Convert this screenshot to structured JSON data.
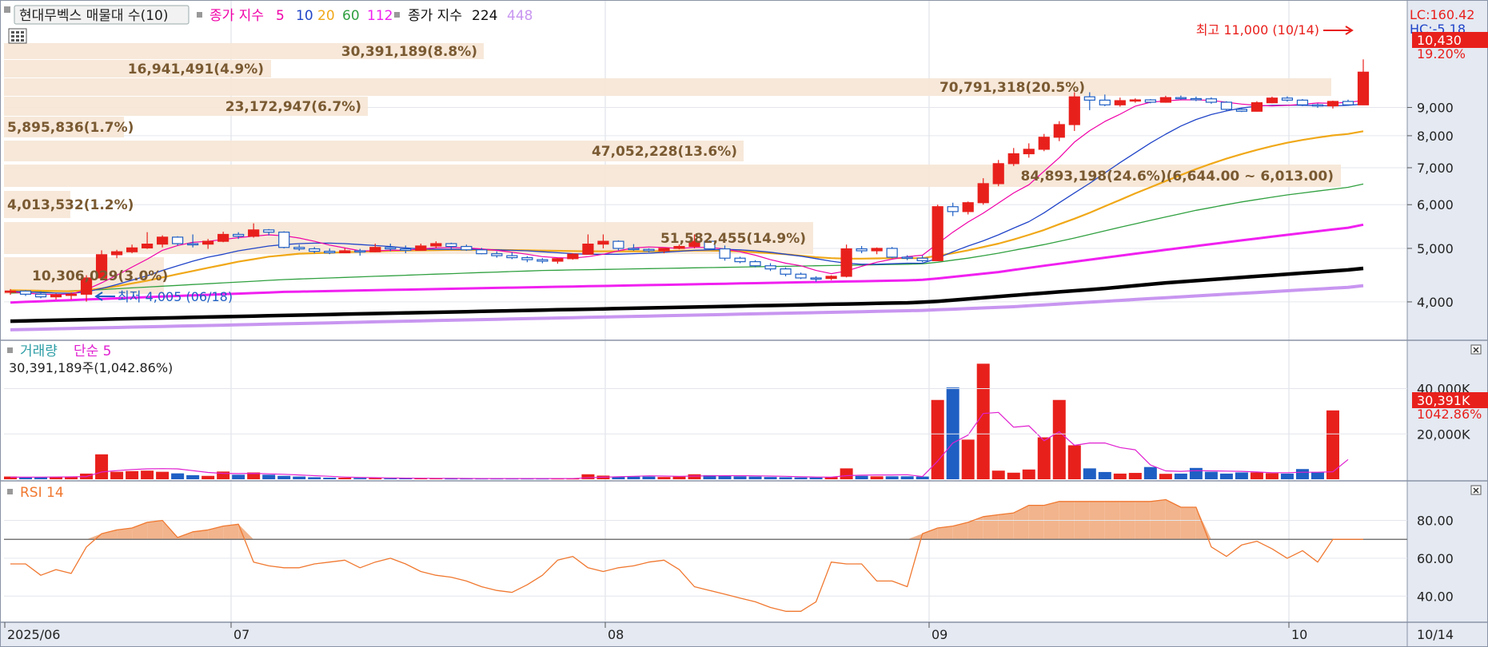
{
  "legend": {
    "title": "현대무벡스 매물대 수(10)",
    "close_label": "종가 지수",
    "ma_periods": [
      "5",
      "10",
      "20",
      "60",
      "112"
    ],
    "close_label_2": "종가 지수",
    "ma_long": [
      "224",
      "448"
    ]
  },
  "colors": {
    "up": "#e8201c",
    "down": "#1f5fc4",
    "ma5": "#f000a8",
    "ma10": "#2145c8",
    "ma20": "#f0a818",
    "ma60": "#30a040",
    "ma112": "#f020f0",
    "ma224": "#000000",
    "ma448": "#c896f0",
    "profile": "#f6e6d6",
    "profile_text": "#7a5a32",
    "rsi_line": "#f07830",
    "rsi_fill": "#f2b48c",
    "vol_ma": "#e020d0"
  },
  "right_axis": {
    "lc": "LC:160.42",
    "hc": "HC:-5.18",
    "price_tag": "10,430",
    "price_change": "19.20%",
    "price_ticks": [
      "9,000",
      "8,000",
      "7,000",
      "6,000",
      "5,000",
      "4,000"
    ],
    "volume_ticks": [
      "40,000K",
      "20,000K"
    ],
    "volume_tag": "30,391K",
    "volume_pct": "1042.86%",
    "rsi_ticks": [
      "80.00",
      "60.00",
      "40.00"
    ]
  },
  "annotations": {
    "high": "최고 11,000 (10/14)",
    "low": "최저 4,005 (06/18)"
  },
  "volume_profile": [
    {
      "label": "30,391,189(8.8%)"
    },
    {
      "label": "16,941,491(4.9%)"
    },
    {
      "label": "70,791,318(20.5%)"
    },
    {
      "label": "23,172,947(6.7%)"
    },
    {
      "label": "5,895,836(1.7%)"
    },
    {
      "label": "47,052,228(13.6%)"
    },
    {
      "label": "84,893,198(24.6%)(6,644.00 ~ 6,013.00)"
    },
    {
      "label": "4,013,532(1.2%)"
    },
    {
      "label": "51,582,455(14.9%)"
    },
    {
      "label": "10,306,029(3.0%)"
    }
  ],
  "volume_panel": {
    "title": "거래량",
    "ma_label": "단순 5",
    "value": "30,391,189주(1,042.86%)"
  },
  "rsi_panel": {
    "title": "RSI 14"
  },
  "x_axis": {
    "labels": [
      "2025/06",
      "07",
      "08",
      "09",
      "10"
    ],
    "current": "10/14"
  },
  "chart_data": {
    "type": "candlestick",
    "title": "현대무벡스",
    "y_scale": "log",
    "ylim": [
      3500,
      11500
    ],
    "candles": [
      [
        4163,
        4220,
        4120,
        4185
      ],
      [
        4185,
        4200,
        4100,
        4130
      ],
      [
        4130,
        4180,
        4060,
        4085
      ],
      [
        4085,
        4140,
        4040,
        4120
      ],
      [
        4120,
        4160,
        4040,
        4130
      ],
      [
        4130,
        4470,
        4005,
        4420
      ],
      [
        4420,
        4960,
        4400,
        4870
      ],
      [
        4870,
        4970,
        4800,
        4930
      ],
      [
        4930,
        5080,
        4900,
        5010
      ],
      [
        5010,
        5350,
        4990,
        5090
      ],
      [
        5090,
        5280,
        5020,
        5240
      ],
      [
        5240,
        5260,
        5060,
        5100
      ],
      [
        5100,
        5300,
        5020,
        5090
      ],
      [
        5090,
        5200,
        4990,
        5150
      ],
      [
        5150,
        5360,
        5130,
        5300
      ],
      [
        5300,
        5350,
        5200,
        5260
      ],
      [
        5260,
        5550,
        5230,
        5400
      ],
      [
        5400,
        5420,
        5280,
        5350
      ],
      [
        5350,
        5370,
        5000,
        5020
      ],
      [
        5020,
        5080,
        4950,
        4990
      ],
      [
        4990,
        5030,
        4900,
        4940
      ],
      [
        4940,
        5000,
        4880,
        4910
      ],
      [
        4910,
        5000,
        4900,
        4950
      ],
      [
        4950,
        4990,
        4850,
        4930
      ],
      [
        4930,
        5100,
        4920,
        5020
      ],
      [
        5020,
        5100,
        4940,
        4990
      ],
      [
        4990,
        5060,
        4900,
        4960
      ],
      [
        4960,
        5100,
        4950,
        5050
      ],
      [
        5050,
        5150,
        5000,
        5100
      ],
      [
        5100,
        5120,
        4980,
        5040
      ],
      [
        5040,
        5080,
        4950,
        4970
      ],
      [
        4970,
        5010,
        4880,
        4890
      ],
      [
        4890,
        4940,
        4810,
        4850
      ],
      [
        4850,
        4920,
        4780,
        4810
      ],
      [
        4810,
        4840,
        4720,
        4770
      ],
      [
        4770,
        4800,
        4700,
        4740
      ],
      [
        4740,
        4800,
        4690,
        4790
      ],
      [
        4790,
        4900,
        4770,
        4880
      ],
      [
        4880,
        5300,
        4870,
        5090
      ],
      [
        5090,
        5300,
        5000,
        5150
      ],
      [
        5150,
        5170,
        4960,
        5000
      ],
      [
        5000,
        5090,
        4950,
        4980
      ],
      [
        4980,
        5000,
        4920,
        4950
      ],
      [
        4950,
        5000,
        4900,
        5000
      ],
      [
        5000,
        5080,
        4980,
        5040
      ],
      [
        5040,
        5300,
        5000,
        5150
      ],
      [
        5150,
        5170,
        4960,
        4990
      ],
      [
        4990,
        5060,
        4750,
        4800
      ],
      [
        4800,
        4830,
        4700,
        4730
      ],
      [
        4730,
        4760,
        4620,
        4650
      ],
      [
        4650,
        4700,
        4550,
        4590
      ],
      [
        4590,
        4620,
        4450,
        4490
      ],
      [
        4490,
        4520,
        4400,
        4420
      ],
      [
        4420,
        4450,
        4350,
        4410
      ],
      [
        4410,
        4470,
        4380,
        4450
      ],
      [
        4450,
        5080,
        4430,
        4990
      ],
      [
        4990,
        5050,
        4900,
        4950
      ],
      [
        4950,
        5020,
        4880,
        5000
      ],
      [
        5000,
        5030,
        4800,
        4820
      ],
      [
        4820,
        4860,
        4760,
        4800
      ],
      [
        4800,
        4850,
        4720,
        4750
      ],
      [
        4750,
        6000,
        4740,
        5950
      ],
      [
        5950,
        6050,
        5720,
        5830
      ],
      [
        5830,
        6080,
        5760,
        6050
      ],
      [
        6050,
        6700,
        6000,
        6550
      ],
      [
        6550,
        7230,
        6480,
        7120
      ],
      [
        7120,
        7600,
        7050,
        7420
      ],
      [
        7420,
        7750,
        7300,
        7560
      ],
      [
        7560,
        8060,
        7500,
        7950
      ],
      [
        7950,
        8500,
        7820,
        8380
      ],
      [
        8380,
        9590,
        8160,
        9410
      ],
      [
        9410,
        9590,
        8900,
        9280
      ],
      [
        9280,
        9500,
        9050,
        9100
      ],
      [
        9100,
        9380,
        9030,
        9260
      ],
      [
        9260,
        9350,
        9180,
        9290
      ],
      [
        9290,
        9320,
        9160,
        9200
      ],
      [
        9200,
        9450,
        9180,
        9380
      ],
      [
        9380,
        9460,
        9300,
        9340
      ],
      [
        9340,
        9420,
        9240,
        9330
      ],
      [
        9330,
        9390,
        9140,
        9200
      ],
      [
        9200,
        9240,
        8880,
        8930
      ],
      [
        8930,
        8990,
        8830,
        8860
      ],
      [
        8860,
        9240,
        8850,
        9180
      ],
      [
        9180,
        9420,
        9160,
        9360
      ],
      [
        9360,
        9430,
        9220,
        9280
      ],
      [
        9280,
        9320,
        9050,
        9100
      ],
      [
        9100,
        9150,
        8990,
        9060
      ],
      [
        9060,
        9260,
        8960,
        9230
      ],
      [
        9230,
        9300,
        9060,
        9100
      ],
      [
        9100,
        11000,
        9090,
        10430
      ]
    ],
    "ma5": [
      4170,
      4150,
      4130,
      4125,
      4132,
      4210,
      4330,
      4470,
      4625,
      4780,
      4960,
      5060,
      5130,
      5150,
      5190,
      5230,
      5260,
      5290,
      5270,
      5220,
      5150,
      5070,
      5010,
      4950,
      4950,
      4960,
      4960,
      4990,
      5010,
      5020,
      5010,
      4990,
      4960,
      4920,
      4880,
      4830,
      4810,
      4800,
      4830,
      4880,
      4950,
      5010,
      5030,
      5020,
      5000,
      5020,
      5020,
      4990,
      4930,
      4860,
      4770,
      4700,
      4650,
      4560,
      4500,
      4550,
      4640,
      4720,
      4780,
      4830,
      4860,
      5100,
      5350,
      5580,
      5790,
      6040,
      6300,
      6520,
      6900,
      7300,
      7790,
      8170,
      8490,
      8750,
      9050,
      9200,
      9250,
      9290,
      9290,
      9270,
      9200,
      9130,
      9080,
      9060,
      9080,
      9120,
      9170,
      9160,
      9200,
      9260
    ],
    "ma10": [
      4180,
      4170,
      4160,
      4150,
      4145,
      4170,
      4230,
      4300,
      4380,
      4460,
      4560,
      4650,
      4740,
      4820,
      4880,
      4950,
      5000,
      5050,
      5080,
      5100,
      5110,
      5110,
      5100,
      5080,
      5060,
      5040,
      5010,
      4990,
      4980,
      4980,
      4980,
      4980,
      4970,
      4960,
      4950,
      4930,
      4910,
      4890,
      4880,
      4880,
      4880,
      4890,
      4900,
      4920,
      4940,
      4960,
      4970,
      4980,
      4970,
      4950,
      4920,
      4880,
      4840,
      4790,
      4740,
      4700,
      4680,
      4680,
      4690,
      4700,
      4700,
      4800,
      4930,
      5050,
      5160,
      5290,
      5440,
      5590,
      5800,
      6050,
      6300,
      6560,
      6850,
      7150,
      7450,
      7760,
      8050,
      8330,
      8560,
      8740,
      8870,
      8980,
      9050,
      9080,
      9090,
      9080,
      9070,
      9060,
      9080,
      9130
    ],
    "ma20": [
      4200,
      4195,
      4190,
      4185,
      4180,
      4200,
      4230,
      4270,
      4320,
      4370,
      4430,
      4490,
      4550,
      4610,
      4670,
      4730,
      4780,
      4830,
      4860,
      4890,
      4900,
      4910,
      4920,
      4930,
      4940,
      4950,
      4955,
      4960,
      4965,
      4970,
      4970,
      4970,
      4968,
      4965,
      4960,
      4955,
      4950,
      4945,
      4940,
      4940,
      4940,
      4940,
      4940,
      4945,
      4950,
      4955,
      4955,
      4950,
      4940,
      4920,
      4900,
      4880,
      4850,
      4820,
      4800,
      4790,
      4790,
      4795,
      4800,
      4800,
      4800,
      4850,
      4900,
      4960,
      5030,
      5100,
      5190,
      5290,
      5400,
      5530,
      5660,
      5800,
      5960,
      6120,
      6290,
      6450,
      6620,
      6790,
      6960,
      7120,
      7270,
      7410,
      7540,
      7660,
      7770,
      7860,
      7940,
      8010,
      8060,
      8150
    ],
    "ma60": [
      4150,
      4160,
      4170,
      4180,
      4190,
      4200,
      4210,
      4225,
      4240,
      4255,
      4270,
      4285,
      4300,
      4315,
      4330,
      4345,
      4360,
      4375,
      4390,
      4400,
      4410,
      4420,
      4430,
      4440,
      4450,
      4460,
      4470,
      4480,
      4490,
      4500,
      4510,
      4520,
      4530,
      4540,
      4550,
      4560,
      4565,
      4570,
      4575,
      4580,
      4585,
      4590,
      4595,
      4600,
      4605,
      4610,
      4615,
      4620,
      4625,
      4630,
      4635,
      4640,
      4645,
      4650,
      4655,
      4660,
      4665,
      4670,
      4675,
      4680,
      4690,
      4720,
      4760,
      4800,
      4850,
      4900,
      4960,
      5020,
      5080,
      5150,
      5220,
      5300,
      5380,
      5460,
      5540,
      5620,
      5700,
      5780,
      5860,
      5930,
      6000,
      6070,
      6130,
      6190,
      6250,
      6300,
      6350,
      6400,
      6450,
      6540
    ],
    "ma112": [
      3990,
      4000,
      4010,
      4020,
      4030,
      4040,
      4050,
      4060,
      4070,
      4080,
      4090,
      4100,
      4110,
      4120,
      4130,
      4140,
      4150,
      4160,
      4170,
      4175,
      4180,
      4185,
      4190,
      4195,
      4200,
      4205,
      4210,
      4215,
      4220,
      4225,
      4230,
      4235,
      4240,
      4245,
      4250,
      4255,
      4260,
      4265,
      4270,
      4275,
      4280,
      4285,
      4290,
      4295,
      4300,
      4305,
      4310,
      4315,
      4320,
      4325,
      4330,
      4335,
      4340,
      4345,
      4350,
      4355,
      4360,
      4365,
      4370,
      4375,
      4385,
      4410,
      4440,
      4470,
      4500,
      4530,
      4570,
      4610,
      4650,
      4690,
      4730,
      4770,
      4810,
      4850,
      4890,
      4930,
      4970,
      5010,
      5050,
      5090,
      5130,
      5170,
      5210,
      5250,
      5290,
      5330,
      5370,
      5410,
      5450,
      5520
    ],
    "ma224": [
      3690,
      3695,
      3700,
      3705,
      3710,
      3715,
      3720,
      3725,
      3730,
      3735,
      3740,
      3745,
      3750,
      3755,
      3760,
      3765,
      3770,
      3775,
      3780,
      3785,
      3790,
      3795,
      3800,
      3805,
      3810,
      3815,
      3820,
      3825,
      3830,
      3835,
      3840,
      3845,
      3850,
      3855,
      3860,
      3865,
      3870,
      3875,
      3880,
      3885,
      3890,
      3895,
      3900,
      3905,
      3910,
      3915,
      3920,
      3925,
      3930,
      3935,
      3940,
      3945,
      3950,
      3955,
      3960,
      3965,
      3970,
      3975,
      3980,
      3985,
      3995,
      4010,
      4030,
      4050,
      4070,
      4090,
      4110,
      4130,
      4150,
      4170,
      4190,
      4210,
      4230,
      4255,
      4280,
      4305,
      4330,
      4350,
      4370,
      4390,
      4410,
      4430,
      4450,
      4470,
      4490,
      4510,
      4530,
      4550,
      4570,
      4600
    ],
    "ma448": [
      3560,
      3565,
      3570,
      3575,
      3580,
      3585,
      3590,
      3595,
      3600,
      3605,
      3610,
      3615,
      3620,
      3625,
      3630,
      3635,
      3640,
      3645,
      3650,
      3655,
      3660,
      3665,
      3670,
      3675,
      3680,
      3685,
      3690,
      3695,
      3700,
      3705,
      3710,
      3715,
      3720,
      3725,
      3730,
      3735,
      3740,
      3745,
      3750,
      3755,
      3760,
      3765,
      3770,
      3775,
      3780,
      3785,
      3790,
      3795,
      3800,
      3805,
      3810,
      3815,
      3820,
      3825,
      3830,
      3835,
      3840,
      3845,
      3850,
      3855,
      3860,
      3870,
      3880,
      3890,
      3900,
      3910,
      3920,
      3935,
      3950,
      3965,
      3980,
      3995,
      4010,
      4025,
      4040,
      4055,
      4070,
      4085,
      4100,
      4115,
      4130,
      4145,
      4160,
      4175,
      4190,
      4205,
      4220,
      4235,
      4250,
      4280
    ],
    "volume_k": [
      1200,
      1000,
      900,
      1100,
      1000,
      2500,
      11000,
      3300,
      3600,
      3800,
      3300,
      2600,
      1800,
      1500,
      3400,
      2000,
      3000,
      2000,
      1500,
      1200,
      900,
      700,
      700,
      600,
      500,
      400,
      500,
      400,
      400,
      300,
      300,
      300,
      300,
      300,
      300,
      300,
      300,
      300,
      2200,
      1600,
      1200,
      1200,
      1200,
      1000,
      1200,
      2200,
      1800,
      1400,
      1300,
      1200,
      1000,
      900,
      800,
      800,
      1000,
      4800,
      1500,
      1300,
      1300,
      1300,
      1200,
      35000,
      40500,
      17500,
      51000,
      3800,
      2900,
      4300,
      18500,
      35000,
      15000,
      4800,
      3200,
      2500,
      2800,
      5400,
      2400,
      2500,
      5000,
      3300,
      2500,
      3000,
      3000,
      2700,
      2500,
      4500,
      3200,
      30391
    ],
    "volume_ma5_k": [
      900,
      900,
      950,
      1000,
      1050,
      1200,
      3200,
      3800,
      4300,
      4600,
      4700,
      4600,
      3800,
      3000,
      2600,
      2500,
      2600,
      2400,
      2200,
      1900,
      1600,
      1300,
      1000,
      800,
      700,
      600,
      500,
      450,
      420,
      380,
      350,
      320,
      310,
      300,
      300,
      300,
      300,
      300,
      650,
      900,
      1100,
      1300,
      1500,
      1400,
      1300,
      1400,
      1500,
      1600,
      1600,
      1500,
      1400,
      1300,
      1100,
      1000,
      900,
      1600,
      1800,
      1900,
      1900,
      2000,
      1200,
      8000,
      16000,
      19500,
      29000,
      29500,
      23000,
      23600,
      17000,
      21000,
      15000,
      16000,
      16000,
      14000,
      13000,
      6300,
      3700,
      3500,
      3800,
      3700,
      3600,
      3500,
      3200,
      2900,
      2900,
      3100,
      3100,
      3300,
      8700
    ],
    "rsi14": [
      57,
      57,
      51,
      54,
      52,
      66,
      73,
      75,
      76,
      79,
      80,
      71,
      74,
      75,
      77,
      78,
      58,
      56,
      55,
      55,
      57,
      58,
      59,
      55,
      58,
      60,
      57,
      53,
      51,
      50,
      48,
      45,
      43,
      42,
      46,
      51,
      59,
      61,
      55,
      53,
      55,
      56,
      58,
      59,
      54,
      45,
      43,
      41,
      39,
      37,
      34,
      32,
      32,
      37,
      58,
      57,
      57,
      48,
      48,
      45,
      73,
      76,
      77,
      79,
      82,
      83,
      84,
      88,
      88,
      90,
      90,
      90,
      90,
      90,
      90,
      90,
      91,
      87,
      87,
      66,
      61,
      67,
      69,
      65,
      60,
      64,
      58,
      70,
      70,
      70
    ],
    "rsi_ylim": [
      30,
      95
    ],
    "rsi_overbought": 70,
    "volume_ylim_k": [
      0,
      55000
    ]
  }
}
